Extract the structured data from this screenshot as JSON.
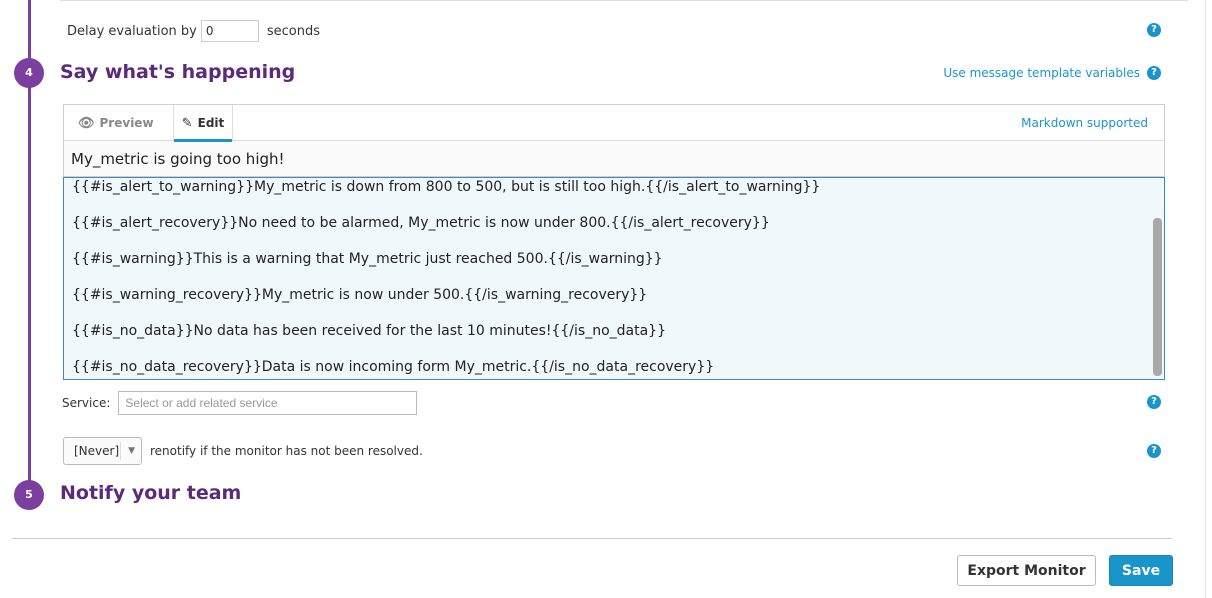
{
  "delay": {
    "label_before": "Delay evaluation by",
    "value": "0",
    "label_after": "seconds"
  },
  "step4": {
    "number": "4",
    "title": "Say what's happening",
    "template_link": "Use message template variables"
  },
  "editor": {
    "tabs": {
      "preview": "Preview",
      "edit": "Edit"
    },
    "markdown_label": "Markdown supported",
    "title_value": "My_metric is going too high!",
    "body_lines": [
      "{{#is_alert_to_warning}}My_metric is down from 800 to 500, but is still too high.{{/is_alert_to_warning}}",
      "{{#is_alert_recovery}}No need to be alarmed, My_metric is now under 800.{{/is_alert_recovery}}",
      "{{#is_warning}}This is a warning that My_metric just reached 500.{{/is_warning}}",
      "{{#is_warning_recovery}}My_metric is now under 500.{{/is_warning_recovery}}",
      "{{#is_no_data}}No data has been received for the last 10 minutes!{{/is_no_data}}",
      "{{#is_no_data_recovery}}Data is now incoming form My_metric.{{/is_no_data_recovery}}"
    ]
  },
  "service": {
    "label": "Service:",
    "placeholder": "Select or add related service"
  },
  "renotify": {
    "selected": "[Never]",
    "text": "renotify if the monitor has not been resolved."
  },
  "step5": {
    "number": "5",
    "title": "Notify your team"
  },
  "footer": {
    "export_label": "Export Monitor",
    "save_label": "Save"
  },
  "help_glyph": "?",
  "icons": {
    "preview": "eye-icon",
    "edit": "edit-pencil-icon",
    "help": "question-circle-icon",
    "select": "chevron-down-icon"
  },
  "colors": {
    "accent": "#1a95c9",
    "step": "#7b3fa0",
    "heading": "#5a2b7d"
  }
}
